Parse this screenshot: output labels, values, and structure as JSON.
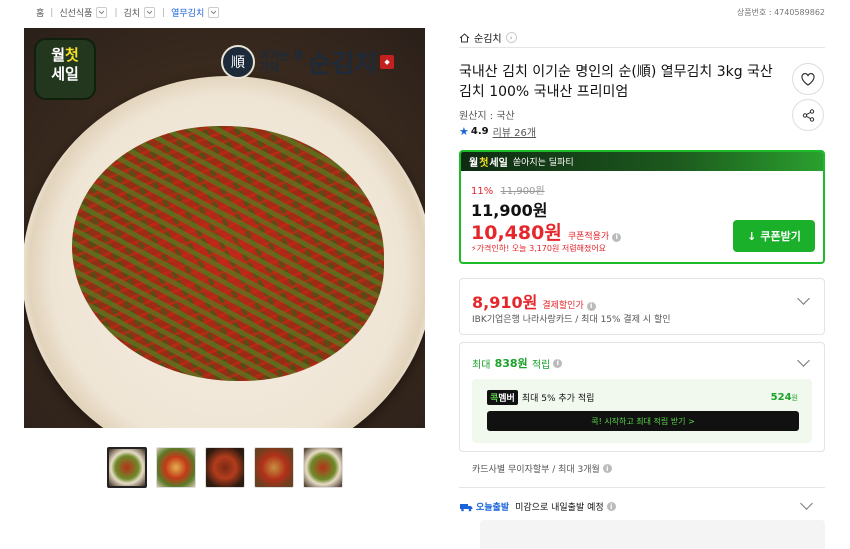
{
  "breadcrumb": {
    "home": "홈",
    "c1": "신선식품",
    "c2": "김치",
    "c3": "열무김치"
  },
  "product_no": "상품번호 : 4740589862",
  "image": {
    "sale_line1": "월",
    "sale_line1b": "첫",
    "sale_line2": "세일",
    "brand_seal": "順",
    "brand_sub": "이기순 명가의",
    "brand_name": "순김치"
  },
  "store": {
    "name": "순김치"
  },
  "title": "국내산 김치 이기순 명인의 순(順) 열무김치 3kg 국산 김치 100% 국내산 프리미엄",
  "origin": "원산지 : 국산",
  "rating": {
    "value": "4.9",
    "reviews": "리뷰 26개"
  },
  "deal": {
    "head_a": "월",
    "head_b": "첫",
    "head_c": "세일",
    "head_label": "쏟아지는 딜파티",
    "discount": "11%",
    "original": "11,900원",
    "price": "11,900원",
    "coupon_price": "10,480원",
    "coupon_label": "쿠폰적용가",
    "note": "가격인하! 오늘 3,170원 저렴해졌어요",
    "coupon_button": "쿠폰받기"
  },
  "card": {
    "price": "8,910원",
    "label": "결제할인가",
    "note": "IBK기업은행 나라사랑카드 / 최대 15% 결제 시 할인"
  },
  "points": {
    "prefix": "최대",
    "amount": "838원",
    "suffix": "적립",
    "member_tag_a": "콕",
    "member_tag_b": "멤버",
    "member_text": "최대 5% 추가 적립",
    "member_points": "524",
    "member_points_unit": "원",
    "member_button": "콕! 시작하고 최대 적립 받기 >"
  },
  "installment": "카드사별 무이자할부 / 최대 3개월",
  "shipping": {
    "label": "오늘출발",
    "text": "미감으로 내일출발 예정"
  },
  "colors": {
    "accent_red": "#e5262b",
    "accent_green": "#1bb02a",
    "accent_blue": "#1a63d8"
  }
}
